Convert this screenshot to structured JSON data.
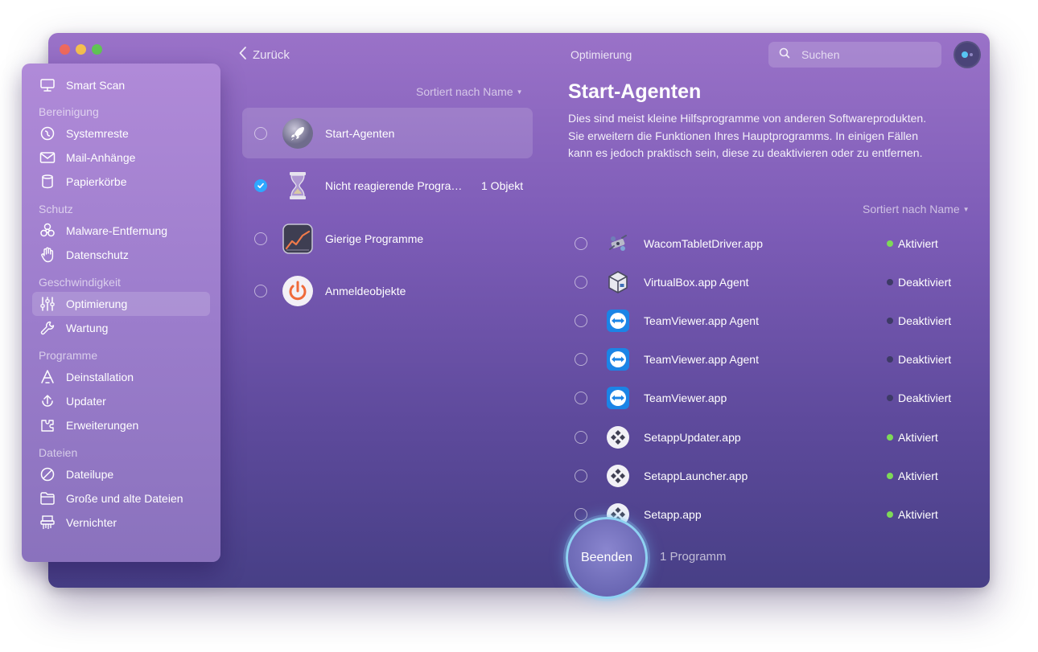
{
  "window": {
    "title": "Optimierung"
  },
  "toolbar": {
    "back_label": "Zurück",
    "search_placeholder": "Suchen"
  },
  "sidebar": {
    "top": [
      {
        "label": "Smart Scan",
        "icon": "smart-scan-icon"
      }
    ],
    "groups": [
      {
        "heading": "Bereinigung",
        "items": [
          {
            "label": "Systemreste",
            "icon": "system-junk-icon"
          },
          {
            "label": "Mail-Anhänge",
            "icon": "mail-icon"
          },
          {
            "label": "Papierkörbe",
            "icon": "trash-icon"
          }
        ]
      },
      {
        "heading": "Schutz",
        "items": [
          {
            "label": "Malware-Entfernung",
            "icon": "biohazard-icon"
          },
          {
            "label": "Datenschutz",
            "icon": "hand-icon"
          }
        ]
      },
      {
        "heading": "Geschwindigkeit",
        "items": [
          {
            "label": "Optimierung",
            "icon": "sliders-icon",
            "active": true
          },
          {
            "label": "Wartung",
            "icon": "wrench-icon"
          }
        ]
      },
      {
        "heading": "Programme",
        "items": [
          {
            "label": "Deinstallation",
            "icon": "uninstaller-icon"
          },
          {
            "label": "Updater",
            "icon": "updater-icon"
          },
          {
            "label": "Erweiterungen",
            "icon": "extensions-icon"
          }
        ]
      },
      {
        "heading": "Dateien",
        "items": [
          {
            "label": "Dateilupe",
            "icon": "lens-icon"
          },
          {
            "label": "Große und alte Dateien",
            "icon": "folder-icon"
          },
          {
            "label": "Vernichter",
            "icon": "shredder-icon"
          }
        ]
      }
    ]
  },
  "categories": {
    "sort_label": "Sortiert nach Name",
    "items": [
      {
        "label": "Start-Agenten",
        "icon": "rocket-icon",
        "selected": true,
        "checked": false,
        "count": ""
      },
      {
        "label": "Nicht reagierende Programme",
        "icon": "hourglass-icon",
        "selected": false,
        "checked": true,
        "count": "1 Objekt"
      },
      {
        "label": "Gierige Programme",
        "icon": "activity-chart-icon",
        "selected": false,
        "checked": false,
        "count": ""
      },
      {
        "label": "Anmeldeobjekte",
        "icon": "power-icon",
        "selected": false,
        "checked": false,
        "count": ""
      }
    ]
  },
  "detail": {
    "title": "Start-Agenten",
    "description": "Dies sind meist kleine Hilfsprogramme von anderen Softwareprodukten. Sie erweitern die Funktionen Ihres Hauptprogramms. In einigen Fällen kann es jedoch praktisch sein, diese zu deaktivieren oder zu entfernen.",
    "sort_label": "Sortiert nach Name",
    "items": [
      {
        "name": "WacomTabletDriver.app",
        "icon": "wacom-icon",
        "status": "Aktiviert",
        "enabled": true
      },
      {
        "name": "VirtualBox.app Agent",
        "icon": "virtualbox-icon",
        "status": "Deaktiviert",
        "enabled": false
      },
      {
        "name": "TeamViewer.app Agent",
        "icon": "teamviewer-icon",
        "status": "Deaktiviert",
        "enabled": false
      },
      {
        "name": "TeamViewer.app Agent",
        "icon": "teamviewer-icon",
        "status": "Deaktiviert",
        "enabled": false
      },
      {
        "name": "TeamViewer.app",
        "icon": "teamviewer-icon",
        "status": "Deaktiviert",
        "enabled": false
      },
      {
        "name": "SetappUpdater.app",
        "icon": "setapp-icon",
        "status": "Aktiviert",
        "enabled": true
      },
      {
        "name": "SetappLauncher.app",
        "icon": "setapp-icon",
        "status": "Aktiviert",
        "enabled": true
      },
      {
        "name": "Setapp.app",
        "icon": "setapp-icon",
        "status": "Aktiviert",
        "enabled": true
      }
    ]
  },
  "action": {
    "button_label": "Beenden",
    "count_label": "1 Programm"
  },
  "colors": {
    "status_enabled": "#7ed957",
    "status_disabled": "#3d3a66",
    "check_blue": "#2ea8ff",
    "stop_ring": "#8fd2f2"
  }
}
